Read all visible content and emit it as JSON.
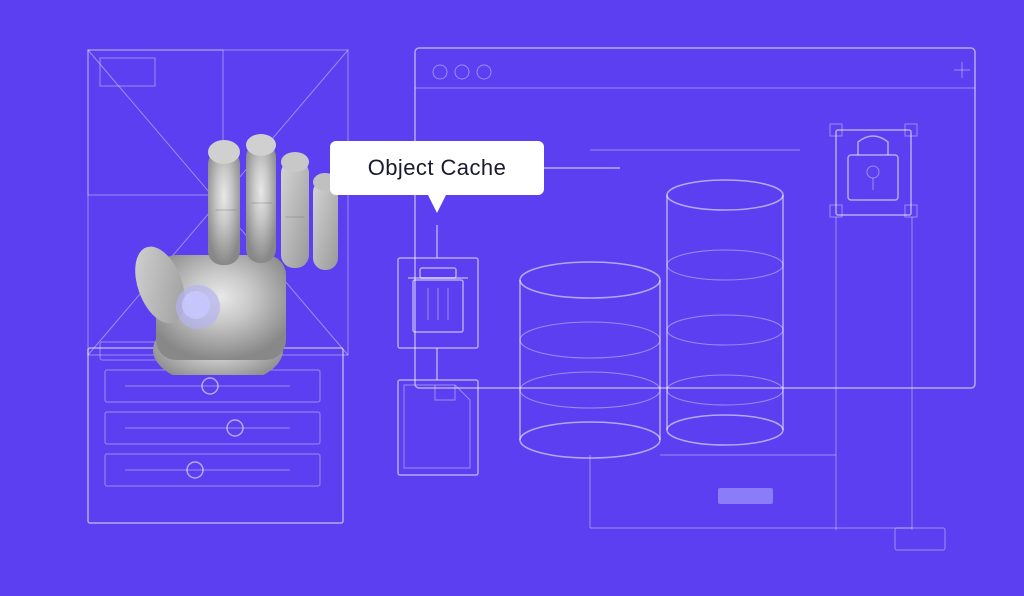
{
  "hero": {
    "background_color": "#5b3ff0",
    "label": "Object Cache",
    "accent_color": "#7c6af7",
    "stroke_color": "rgba(255,255,255,0.55)"
  }
}
